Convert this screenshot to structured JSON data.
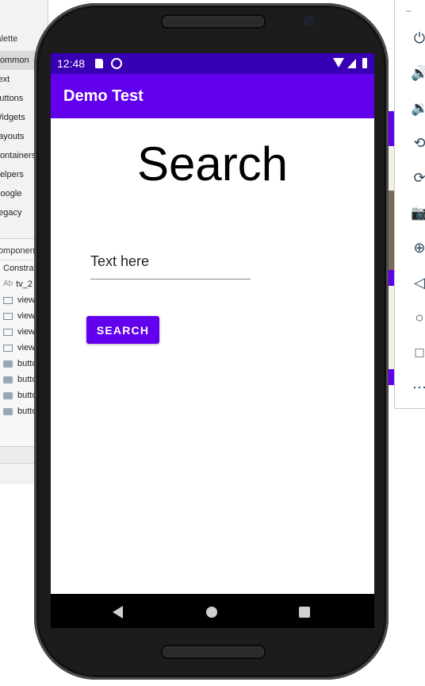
{
  "ide": {
    "palette_header": "Palette",
    "palette_items": [
      "Common",
      "Text",
      "Buttons",
      "Widgets",
      "Layouts",
      "Containers",
      "Helpers",
      "Google",
      "Legacy"
    ],
    "palette_selected": "Common",
    "tree_header": "Component Tree",
    "tree_items": [
      {
        "icon": "text-ab",
        "label": "ConstraintLayout"
      },
      {
        "icon": "text-ab",
        "label": "tv_2"
      },
      {
        "icon": "view-rect",
        "label": "view"
      },
      {
        "icon": "view-rect",
        "label": "view"
      },
      {
        "icon": "view-rect",
        "label": "view"
      },
      {
        "icon": "view-rect",
        "label": "view"
      },
      {
        "icon": "btn-rect",
        "label": "button"
      },
      {
        "icon": "btn-rect",
        "label": "button"
      },
      {
        "icon": "btn-rect",
        "label": "button"
      },
      {
        "icon": "btn-rect",
        "label": "button"
      }
    ]
  },
  "emulator_toolbar": {
    "minimize_label": "–",
    "icons": [
      "power-icon",
      "volume-up-icon",
      "volume-down-icon",
      "rotate-left-icon",
      "rotate-right-icon",
      "camera-icon",
      "zoom-icon",
      "back-icon",
      "home-icon",
      "overview-icon",
      "more-icon"
    ]
  },
  "status_bar": {
    "time": "12:48",
    "icons": [
      "sd-card-icon",
      "sync-icon",
      "wifi-icon",
      "signal-icon",
      "battery-icon"
    ]
  },
  "app_bar": {
    "title": "Demo Test"
  },
  "main": {
    "heading": "Search",
    "input_placeholder": "Text here",
    "input_value": "",
    "button_label": "SEARCH"
  },
  "nav_bar": {
    "icons": [
      "nav-back-icon",
      "nav-home-icon",
      "nav-recents-icon"
    ]
  },
  "colors": {
    "primary": "#6200ee",
    "primary_dark": "#3700b3",
    "background": "#ffffff"
  }
}
